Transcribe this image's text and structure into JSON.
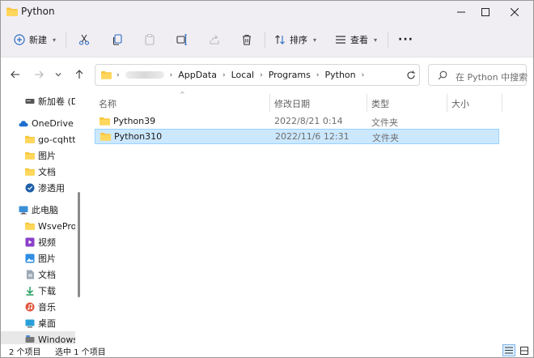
{
  "window": {
    "title": "Python"
  },
  "toolbar": {
    "new_label": "新建",
    "sort_label": "排序",
    "view_label": "查看"
  },
  "address": {
    "crumbs": [
      "AppData",
      "Local",
      "Programs",
      "Python"
    ]
  },
  "search": {
    "placeholder": "在 Python 中搜索"
  },
  "sidebar": {
    "items": [
      {
        "label": "新加卷 (D",
        "icon": "drive-icon"
      },
      {
        "label": "OneDrive -",
        "icon": "cloud-icon"
      },
      {
        "label": "go-cqhtt",
        "icon": "folder-icon"
      },
      {
        "label": "图片",
        "icon": "folder-icon"
      },
      {
        "label": "文档",
        "icon": "folder-icon"
      },
      {
        "label": "渗透用",
        "icon": "shield-folder-icon"
      },
      {
        "label": "此电脑",
        "icon": "computer-icon"
      },
      {
        "label": "WsveProj",
        "icon": "folder-icon"
      },
      {
        "label": "视频",
        "icon": "video-icon"
      },
      {
        "label": "图片",
        "icon": "picture-icon"
      },
      {
        "label": "文档",
        "icon": "document-icon"
      },
      {
        "label": "下载",
        "icon": "download-icon"
      },
      {
        "label": "音乐",
        "icon": "music-icon"
      },
      {
        "label": "桌面",
        "icon": "desktop-icon"
      },
      {
        "label": "Windows",
        "icon": "windows-drive-icon"
      }
    ]
  },
  "columns": [
    "名称",
    "修改日期",
    "类型",
    "大小"
  ],
  "files": [
    {
      "name": "Python39",
      "date": "2022/8/21 0:14",
      "type": "文件夹"
    },
    {
      "name": "Python310",
      "date": "2022/11/6 12:31",
      "type": "文件夹"
    }
  ],
  "status": {
    "count": "2 个项目",
    "selected": "选中 1 个项目"
  },
  "colors": {
    "accent_selection": "#cce8ff",
    "selection_border": "#99d1ff",
    "folder_yellow": "#f8c73f",
    "title_bg": "#f1eef3"
  }
}
